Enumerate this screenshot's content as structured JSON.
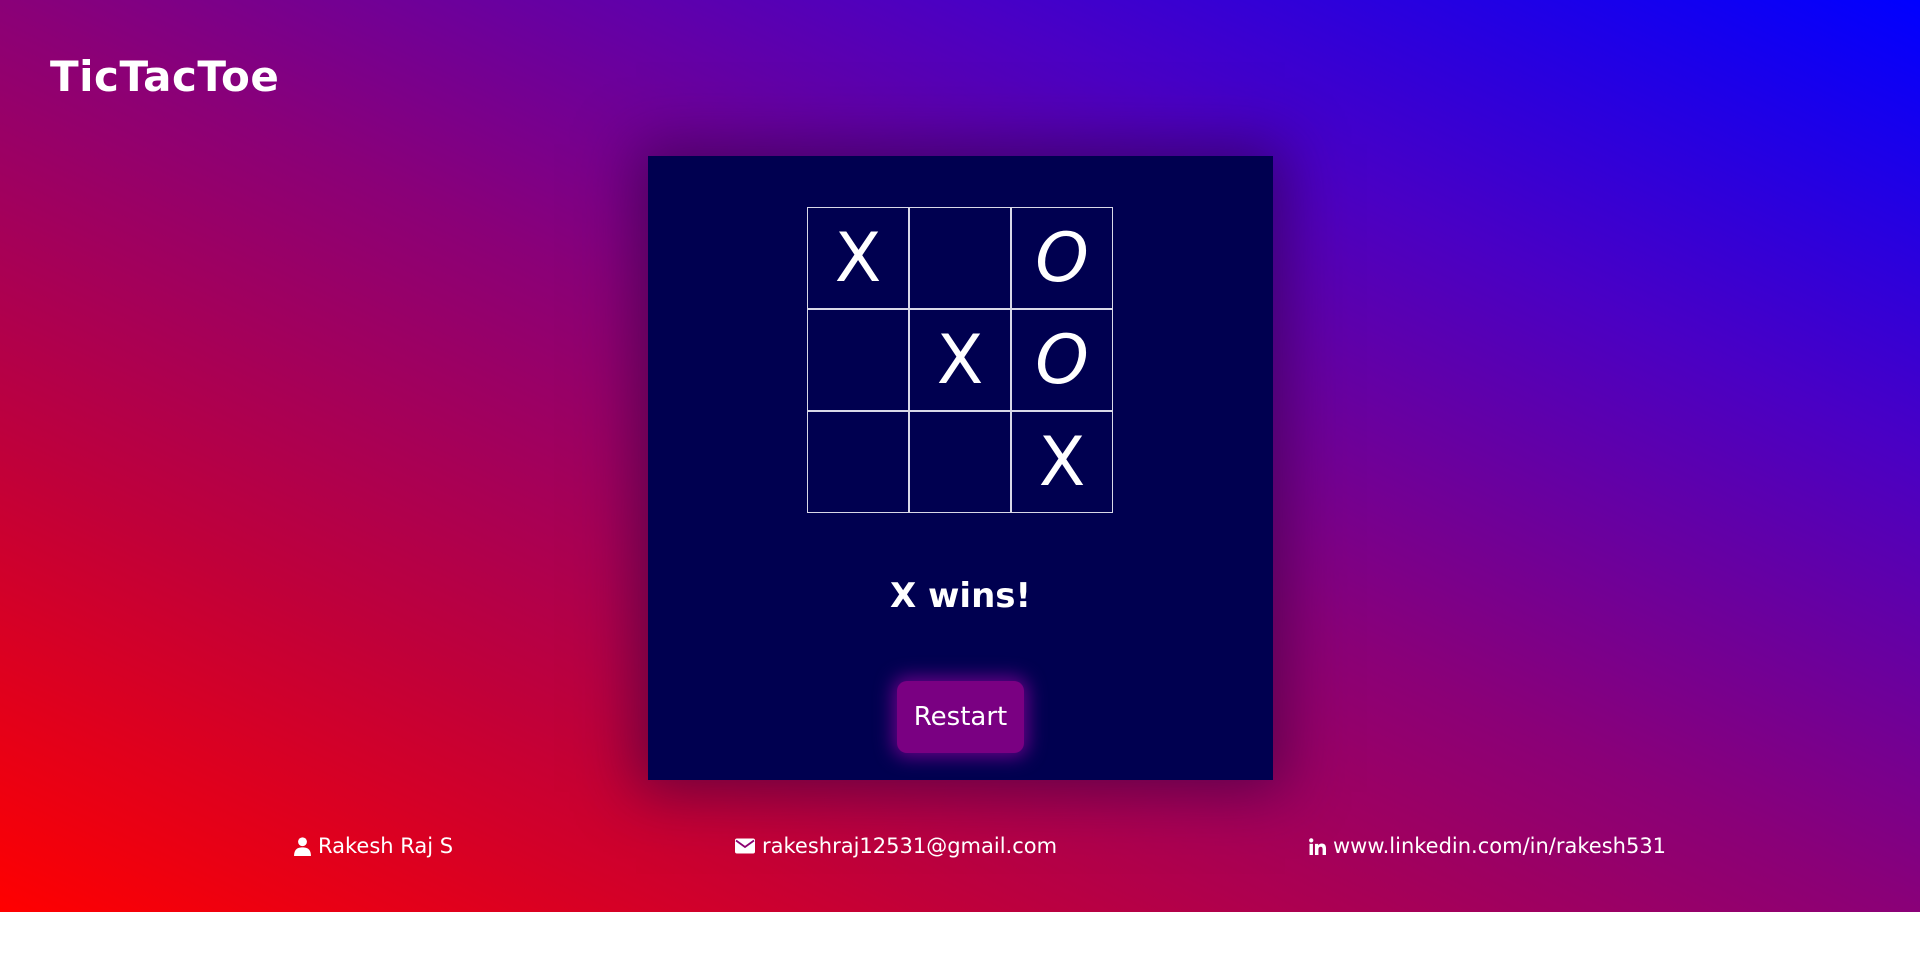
{
  "header": {
    "title": "TicTacToe"
  },
  "board": {
    "cells": [
      "X",
      "",
      "O",
      "",
      "X",
      "O",
      "",
      "",
      "X"
    ]
  },
  "status": "X wins!",
  "controls": {
    "restart_label": "Restart"
  },
  "footer": {
    "name": "Rakesh Raj S",
    "email": "rakeshraj12531@gmail.com",
    "linkedin": "www.linkedin.com/in/rakesh531"
  },
  "icons": {
    "name": "user-icon",
    "email": "envelope-icon",
    "linkedin": "linkedin-icon"
  },
  "colors": {
    "gradient_start": "#ff0000",
    "gradient_end": "#0000ff",
    "panel": "#000050",
    "button": "#7a0082",
    "text": "#ffffff"
  }
}
